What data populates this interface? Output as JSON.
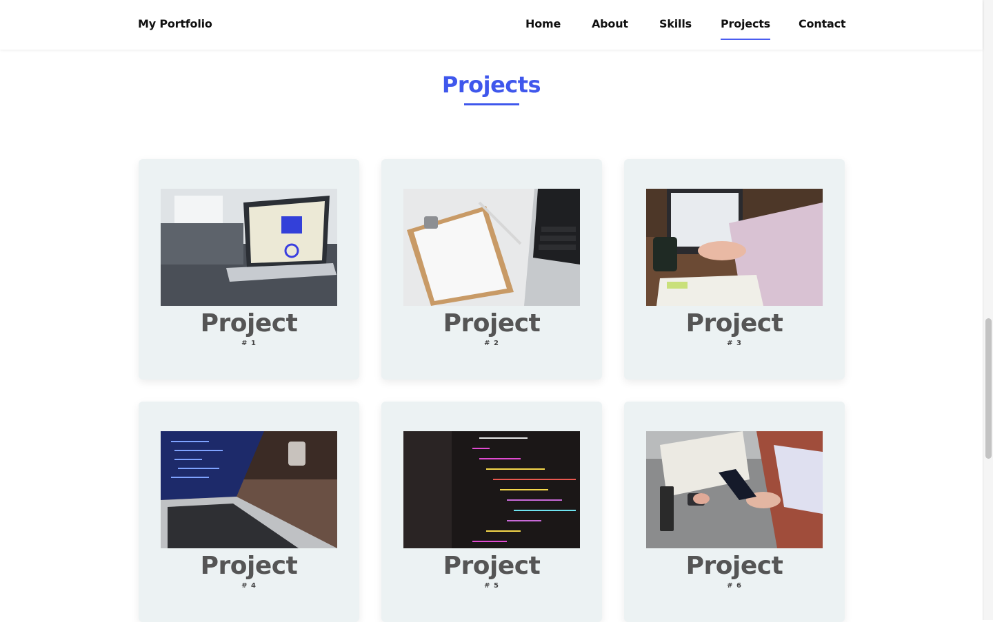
{
  "header": {
    "brand": "My Portfolio",
    "nav": [
      {
        "label": "Home"
      },
      {
        "label": "About"
      },
      {
        "label": "Skills"
      },
      {
        "label": "Projects",
        "active": true
      },
      {
        "label": "Contact"
      }
    ]
  },
  "section": {
    "title": "Projects"
  },
  "projects": [
    {
      "title": "Project",
      "number": "# 1",
      "image": "laptop-dashboard-image"
    },
    {
      "title": "Project",
      "number": "# 2",
      "image": "clipboard-laptop-image"
    },
    {
      "title": "Project",
      "number": "# 3",
      "image": "person-typing-laptop-image"
    },
    {
      "title": "Project",
      "number": "# 4",
      "image": "laptop-code-image"
    },
    {
      "title": "Project",
      "number": "# 5",
      "image": "code-screen-image"
    },
    {
      "title": "Project",
      "number": "# 6",
      "image": "phone-notebook-image"
    }
  ],
  "colors": {
    "accent": "#3f57ec",
    "card_bg": "#ecf2f3",
    "card_title": "#555555"
  }
}
